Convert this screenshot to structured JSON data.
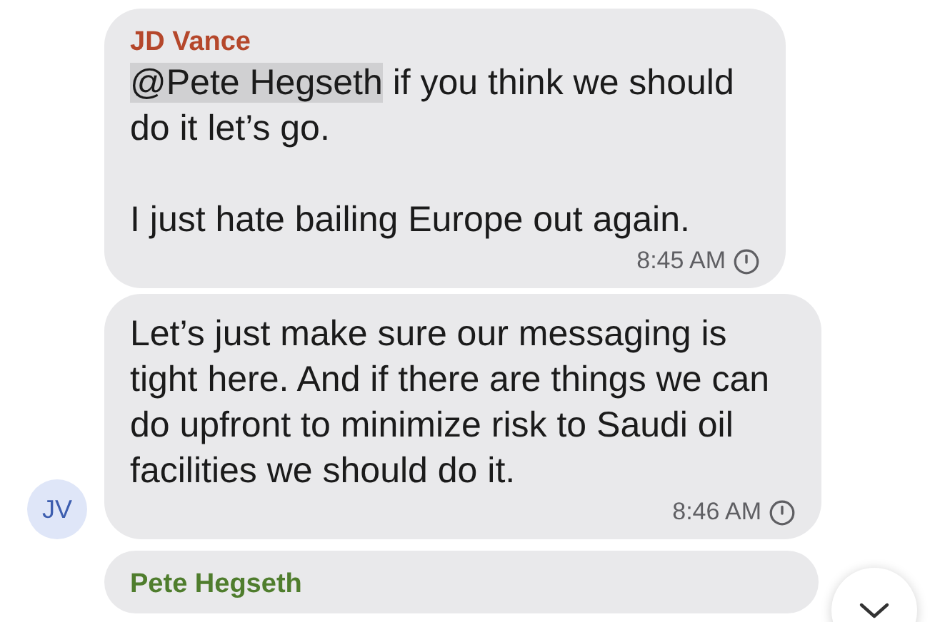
{
  "messages": [
    {
      "sender": "JD Vance",
      "color": "#b5472b",
      "paragraphs": [
        [
          {
            "text": "@Pete Hegseth",
            "mention": true
          },
          {
            "text": " if you think we should do it let’s go.",
            "mention": false
          }
        ],
        [
          {
            "text": "I just hate bailing Europe out again.",
            "mention": false
          }
        ]
      ],
      "time": "8:45 AM"
    },
    {
      "paragraphs": [
        [
          {
            "text": "Let’s just make sure our messaging is tight here. And if there are things we can do upfront to minimize risk to Saudi oil facilities we should do it.",
            "mention": false
          }
        ]
      ],
      "time": "8:46 AM",
      "avatar": "JV"
    },
    {
      "sender": "Pete Hegseth",
      "color": "#4f7d2d"
    }
  ]
}
